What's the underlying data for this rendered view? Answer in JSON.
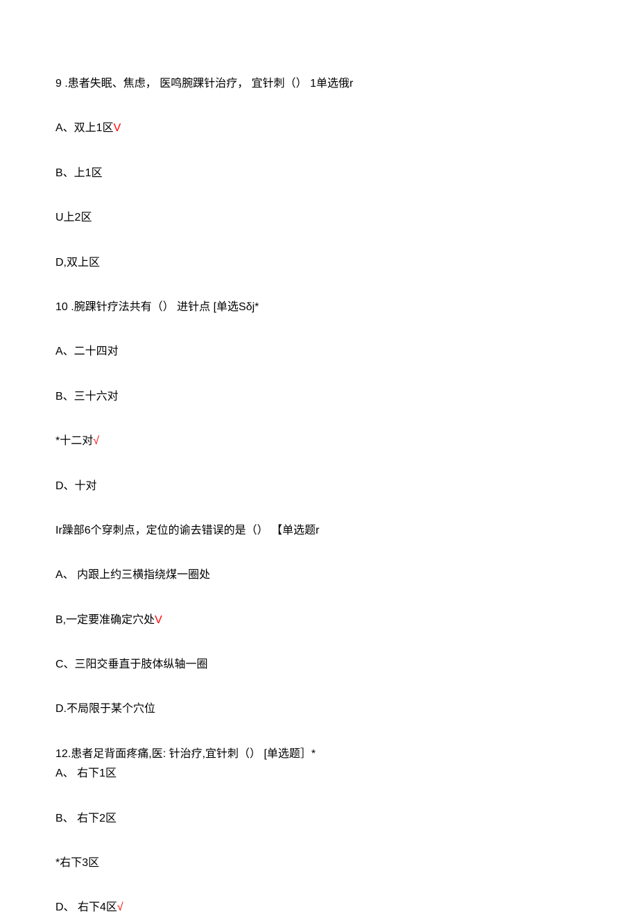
{
  "q9": {
    "text": "9    .患者失眠、焦虑，  医鸣腕踝针治疗，  宜针刺（） 1单选俄r",
    "a_prefix": "A、双上1区",
    "a_mark": "V",
    "b": "B、上1区",
    "c": "U上2区",
    "d": "D,双上区"
  },
  "q10": {
    "text": "10    .腕踝针疗法共有（） 进针点  [单选Sδj*",
    "a": "A、二十四对",
    "b": "B、三十六对",
    "c_prefix": "*十二对",
    "c_mark": "√",
    "d": "D、十对"
  },
  "q11": {
    "text": "Ir躁部6个穿刺点，定位的谕去错误的是（） 【单选题r",
    "a": "A、 内跟上约三横指绕煤一圈处",
    "b_prefix": "B,一定要准确定穴处",
    "b_mark": "V",
    "c": "C、三阳交垂直于肢体纵轴一圈",
    "d": "D.不局限于某个穴位"
  },
  "q12": {
    "text": "12.患者足背面疼痛,医:             针治疗,宜针刺（）   [单选题］*",
    "a": "A、 右下1区",
    "b": "B、 右下2区",
    "c": "*右下3区",
    "d_prefix": "D、 右下4区",
    "d_mark": "√"
  }
}
